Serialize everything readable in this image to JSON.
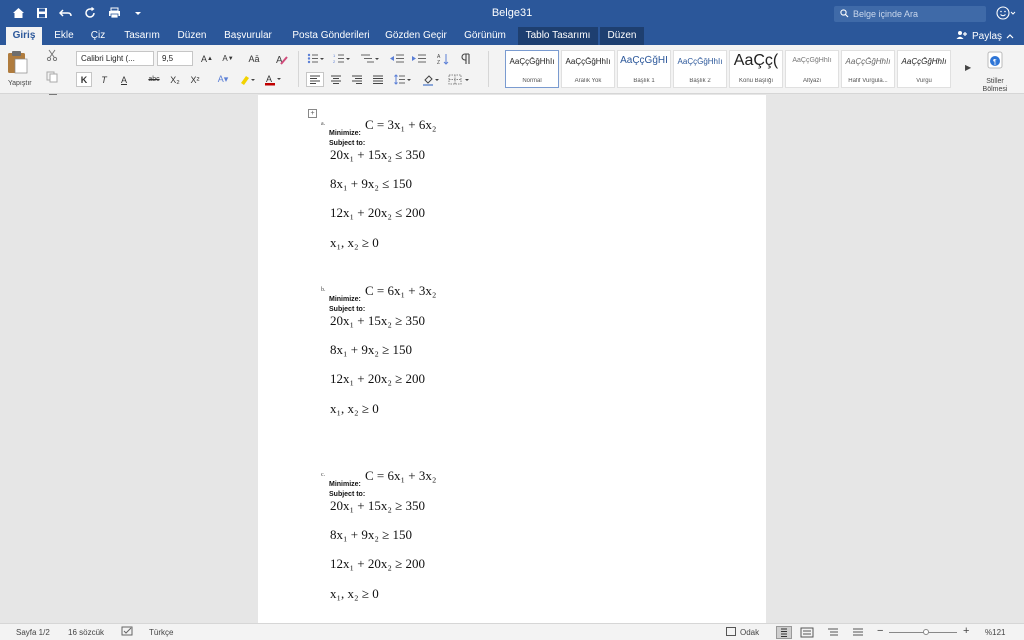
{
  "window": {
    "title": "Belge31"
  },
  "search": {
    "placeholder": "Belge içinde Ara"
  },
  "tabs": [
    "Giriş",
    "Ekle",
    "Çiz",
    "Tasarım",
    "Düzen",
    "Başvurular",
    "Posta Gönderileri",
    "Gözden Geçir",
    "Görünüm",
    "Tablo Tasarımı",
    "Düzen"
  ],
  "share_label": "Paylaş",
  "ribbon": {
    "paste_label": "Yapıştır",
    "font_name": "Calibri Light (...",
    "font_size": "9,5",
    "bold": "K",
    "italic": "T",
    "underline": "A",
    "strike": "abc",
    "subscript": "X₂",
    "superscript": "X²",
    "styles": [
      {
        "sample": "AaÇçĞğHhIı",
        "name": "Normal"
      },
      {
        "sample": "AaÇçĞğHhIı",
        "name": "Aralık Yok"
      },
      {
        "sample": "AaÇçĞğHI",
        "name": "Başlık 1"
      },
      {
        "sample": "AaÇçĞğHhIı",
        "name": "Başlık 2"
      },
      {
        "sample": "AaÇç(",
        "name": "Konu Başlığı"
      },
      {
        "sample": "AaÇçĞğHhIı",
        "name": "Altyazı"
      },
      {
        "sample": "AaÇçĞğHhIı",
        "name": "Hafif Vurgula..."
      },
      {
        "sample": "AaÇçĞğHhIı",
        "name": "Vurgu"
      }
    ],
    "style_pane_label": "Stiller Bölmesi"
  },
  "document": {
    "problems": [
      {
        "label": "a.",
        "objective": "C = 3x₁ + 6x₂",
        "minimize": "Minimize:",
        "subject_to": "Subject to:",
        "constraints": [
          "20x₁ + 15x₂ ≤ 350",
          "8x₁ + 9x₂ ≤ 150",
          "12x₁ + 20x₂ ≤ 200",
          "x₁, x₂ ≥ 0"
        ]
      },
      {
        "label": "b.",
        "objective": "C = 6x₁ + 3x₂",
        "minimize": "Minimize:",
        "subject_to": "Subject to:",
        "constraints": [
          "20x₁ + 15x₂ ≥ 350",
          "8x₁ + 9x₂ ≥ 150",
          "12x₁ + 20x₂ ≥ 200",
          "x₁, x₂ ≥ 0"
        ]
      },
      {
        "label": "c.",
        "objective": "C = 6x₁ + 3x₂",
        "minimize": "Minimize:",
        "subject_to": "Subject to:",
        "constraints": [
          "20x₁ + 15x₂ ≥ 350",
          "8x₁ + 9x₂ ≥ 150",
          "12x₁ + 20x₂ ≥ 200",
          "x₁, x₂ ≥ 0"
        ]
      }
    ]
  },
  "status": {
    "page": "Sayfa 1/2",
    "words": "16 sözcük",
    "language": "Türkçe",
    "focus": "Odak",
    "zoom": "%121"
  },
  "colors": {
    "accent": "#2b579a",
    "ribbon": "#f3f3f3",
    "canvas": "#e6e6e6"
  }
}
